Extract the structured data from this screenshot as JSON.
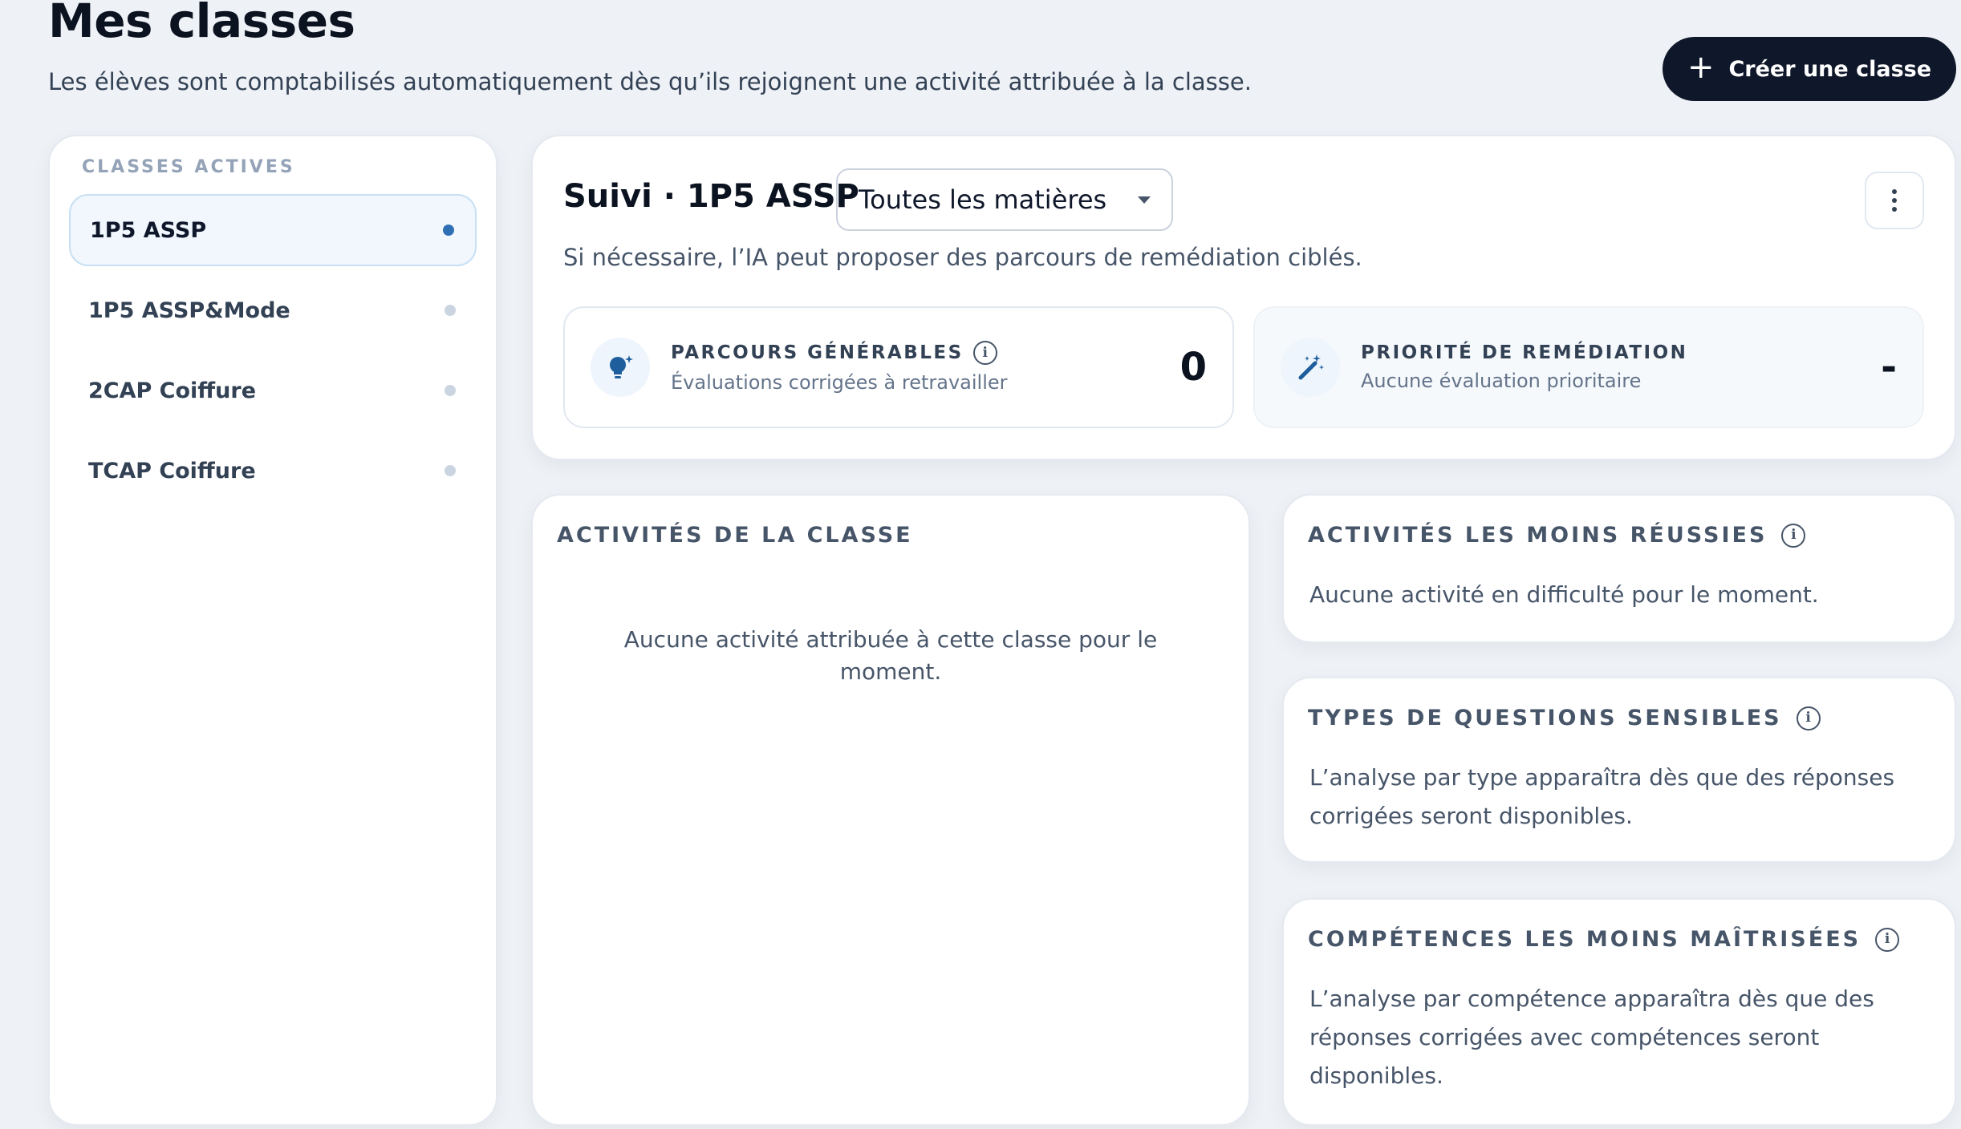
{
  "page": {
    "title": "Mes classes",
    "subtitle": "Les élèves sont comptabilisés automatiquement dès qu’ils rejoignent une activité attribuée à la classe.",
    "create_label": "Créer une classe"
  },
  "sidebar": {
    "heading": "CLASSES ACTIVES",
    "items": [
      {
        "label": "1P5 ASSP",
        "active": true
      },
      {
        "label": "1P5 ASSP&Mode",
        "active": false
      },
      {
        "label": "2CAP Coiffure",
        "active": false
      },
      {
        "label": "TCAP Coiffure",
        "active": false
      }
    ]
  },
  "suivi": {
    "title": "Suivi · 1P5 ASSP",
    "subject_selected": "Toutes les matières",
    "subtitle": "Si nécessaire, l’IA peut proposer des parcours de remédiation ciblés.",
    "stats": [
      {
        "label": "PARCOURS GÉNÉRABLES",
        "desc": "Évaluations corrigées à retravailler",
        "value": "0",
        "icon": "lightbulb-icon"
      },
      {
        "label": "PRIORITÉ DE REMÉDIATION",
        "desc": "Aucune évaluation prioritaire",
        "value": "-",
        "icon": "magic-wand-icon"
      }
    ]
  },
  "activities": {
    "heading": "ACTIVITÉS DE LA CLASSE",
    "empty": "Aucune activité attribuée à cette classe pour le moment."
  },
  "insights": [
    {
      "heading": "ACTIVITÉS LES MOINS RÉUSSIES",
      "text": "Aucune activité en difficulté pour le moment."
    },
    {
      "heading": "TYPES DE QUESTIONS SENSIBLES",
      "text": "L’analyse par type apparaîtra dès que des réponses corrigées seront disponibles."
    },
    {
      "heading": "COMPÉTENCES LES MOINS MAÎTRISÉES",
      "text": "L’analyse par compétence apparaîtra dès que des réponses corrigées avec compétences seront disponibles."
    }
  ],
  "colors": {
    "accent": "#2f6fb3",
    "primary_button": "#0f172a",
    "background": "#eef1f5"
  }
}
